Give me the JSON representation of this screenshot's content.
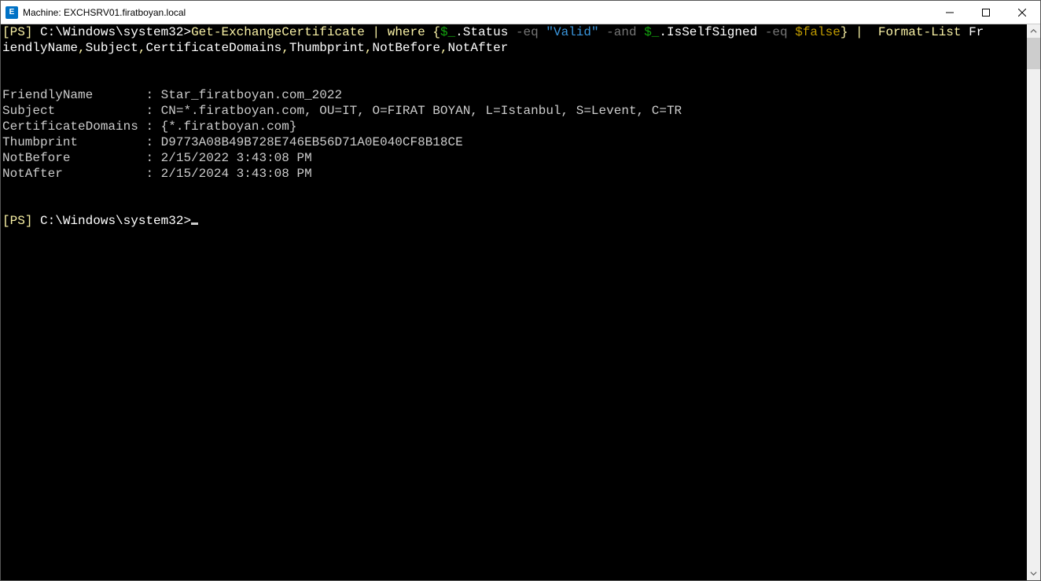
{
  "window": {
    "icon_letter": "E",
    "title": "Machine: EXCHSRV01.firatboyan.local"
  },
  "terminal": {
    "prompt_open": "[",
    "prompt_ps": "PS",
    "prompt_close": "]",
    "prompt_path": " C:\\Windows\\system32>",
    "cmd": {
      "c1": "Get-ExchangeCertificate ",
      "pipe1": "|",
      "c2": " where ",
      "brace_open": "{",
      "dollar1": "$_",
      "dot_status": ".Status ",
      "eq1": "-eq ",
      "valid": "\"Valid\" ",
      "and": "-and ",
      "dollar2": "$_",
      "dot_iss": ".IsSelfSigned ",
      "eq2": "-eq ",
      "false": "$false",
      "brace_close": "}",
      "pipe2": " | ",
      "format": " Format-List ",
      "cols1": "Fr",
      "cols2": "iendlyName",
      "comma1": ",",
      "cols3": "Subject",
      "comma2": ",",
      "cols4": "CertificateDomains",
      "comma3": ",",
      "cols5": "Thumbprint",
      "comma4": ",",
      "cols6": "NotBefore",
      "comma5": ",",
      "cols7": "NotAfter"
    },
    "output": {
      "l1k": "FriendlyName       ",
      "l1v": ": Star_firatboyan.com_2022",
      "l2k": "Subject            ",
      "l2v": ": CN=*.firatboyan.com, OU=IT, O=FIRAT BOYAN, L=Istanbul, S=Levent, C=TR",
      "l3k": "CertificateDomains ",
      "l3v": ": {*.firatboyan.com}",
      "l4k": "Thumbprint         ",
      "l4v": ": D9773A08B49B728E746EB56D71A0E040CF8B18CE",
      "l5k": "NotBefore          ",
      "l5v": ": 2/15/2022 3:43:08 PM",
      "l6k": "NotAfter           ",
      "l6v": ": 2/15/2024 3:43:08 PM"
    }
  }
}
